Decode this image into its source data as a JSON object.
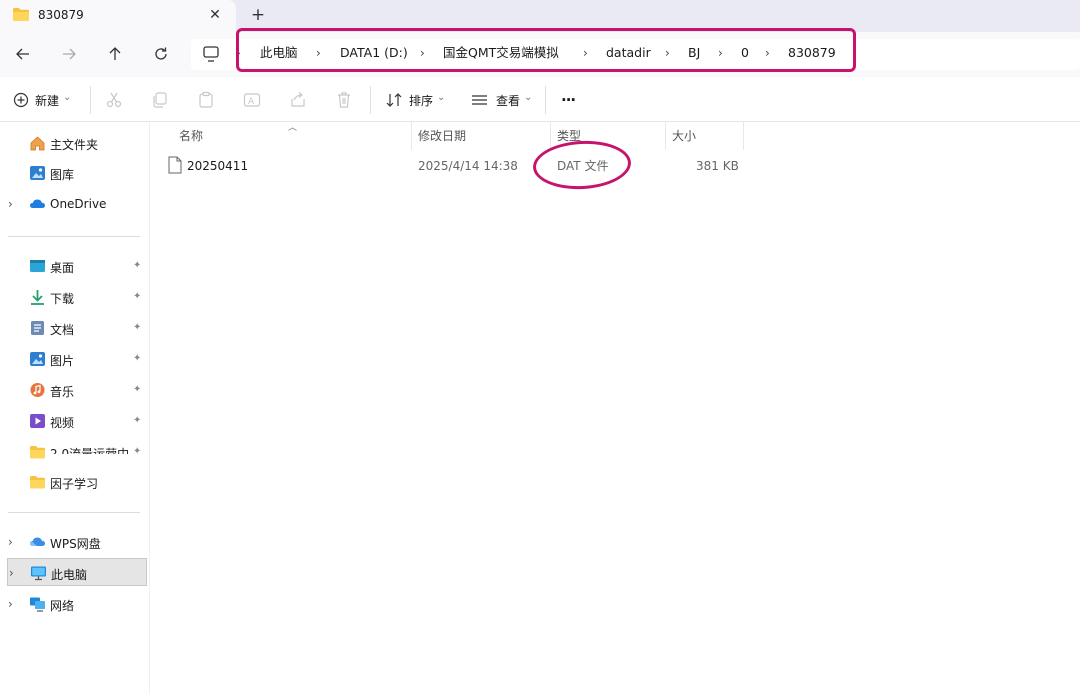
{
  "tab": {
    "title": "830879",
    "close_glyph": "✕",
    "new_tab_glyph": "+"
  },
  "nav": {
    "back_icon": "arrow-left-icon",
    "forward_icon": "arrow-right-icon",
    "up_icon": "arrow-up-icon",
    "refresh_icon": "refresh-icon"
  },
  "breadcrumb": {
    "separator": "›",
    "items": [
      "此电脑",
      "DATA1 (D:)",
      "国金QMT交易端模拟",
      "datadir",
      "BJ",
      "0",
      "830879"
    ]
  },
  "toolbar": {
    "new_label": "新建",
    "sort_label": "排序",
    "view_label": "查看",
    "more_label": "···",
    "dropdown_glyph": "⌄"
  },
  "sidebar": {
    "top": [
      {
        "label": "主文件夹",
        "icon": "home-icon"
      },
      {
        "label": "图库",
        "icon": "gallery-icon"
      },
      {
        "label": "OneDrive",
        "icon": "cloud-icon",
        "expandable": true
      }
    ],
    "pinned": [
      {
        "label": "桌面",
        "icon": "desktop-icon"
      },
      {
        "label": "下载",
        "icon": "download-icon"
      },
      {
        "label": "文档",
        "icon": "document-icon"
      },
      {
        "label": "图片",
        "icon": "picture-icon"
      },
      {
        "label": "音乐",
        "icon": "music-icon"
      },
      {
        "label": "视频",
        "icon": "video-icon"
      },
      {
        "label": "2.0流量运营中",
        "icon": "folder-icon"
      },
      {
        "label": "因子学习",
        "icon": "folder-icon"
      }
    ],
    "bottom": [
      {
        "label": "WPS网盘",
        "icon": "wps-cloud-icon"
      },
      {
        "label": "此电脑",
        "icon": "computer-icon",
        "selected": true
      },
      {
        "label": "网络",
        "icon": "network-icon"
      }
    ],
    "pin_glyph": "📌"
  },
  "columns": {
    "name": "名称",
    "modified": "修改日期",
    "type": "类型",
    "size": "大小"
  },
  "files": [
    {
      "name": "20250411",
      "modified": "2025/4/14 14:38",
      "type": "DAT 文件",
      "size": "381 KB"
    }
  ],
  "colors": {
    "highlight": "#c6146e",
    "tab_bg": "#eaeaf4",
    "accent": "#0067c0"
  }
}
